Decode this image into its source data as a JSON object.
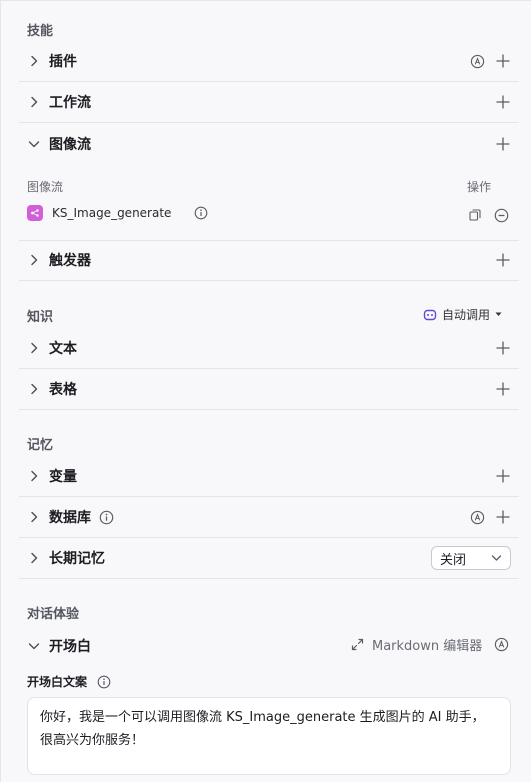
{
  "skills": {
    "title": "技能",
    "plugin": "插件",
    "workflow": "工作流",
    "imageflow": "图像流",
    "imageflow_col_name": "图像流",
    "imageflow_col_ops": "操作",
    "imageflow_item": "KS_Image_generate",
    "trigger": "触发器"
  },
  "knowledge": {
    "title": "知识",
    "auto_call": "自动调用",
    "text": "文本",
    "table": "表格"
  },
  "memory": {
    "title": "记忆",
    "variables": "变量",
    "database": "数据库",
    "long_term": "长期记忆",
    "long_term_value": "关闭"
  },
  "dialog": {
    "title": "对话体验",
    "opener": "开场白",
    "md_editor": "Markdown 编辑器",
    "opener_text_label": "开场白文案",
    "opener_text": "你好，我是一个可以调用图像流 KS_Image_generate 生成图片的 AI 助手，\n很高兴为你服务！"
  },
  "colors": {
    "imageflow_badge": "#d15fd8",
    "auto_call_accent": "#5b4bdb"
  },
  "icons": [
    "chevron-right-icon",
    "chevron-down-icon",
    "plus-icon",
    "auto-a-icon",
    "info-icon",
    "copy-icon",
    "remove-icon",
    "bot-icon",
    "expand-icon"
  ]
}
